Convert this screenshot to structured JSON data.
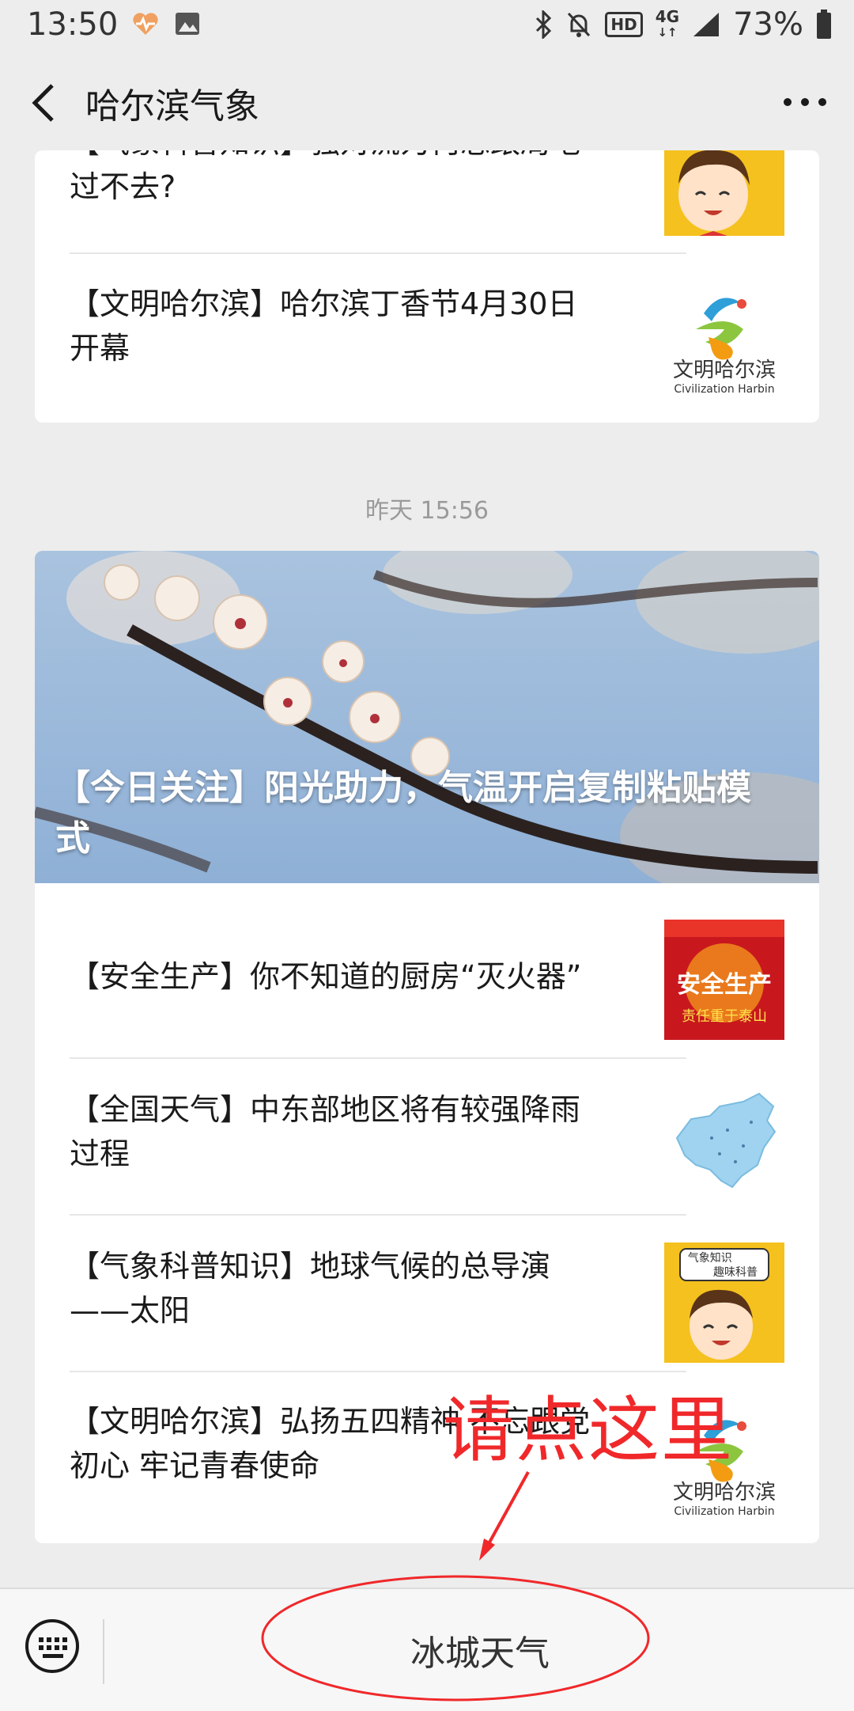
{
  "status_bar": {
    "time": "13:50",
    "battery": "73%",
    "hd_label": "HD",
    "network_label": "4G",
    "network_sub": "↓↑"
  },
  "nav": {
    "title": "哈尔滨气象"
  },
  "top_card": {
    "items": [
      {
        "title_partial": "【气象科普知识】强对流为何总跟局地",
        "title": "过不去?"
      },
      {
        "title": "【文明哈尔滨】哈尔滨丁香节4月30日\n开幕"
      }
    ]
  },
  "timestamp": "昨天 15:56",
  "main_card": {
    "cover_title": "【今日关注】阳光助力，气温开启复制粘贴模\n式",
    "items": [
      {
        "title": "【安全生产】你不知道的厨房“灭火器”",
        "thumb_caption": "安全生产",
        "thumb_sub": "责任重于泰山"
      },
      {
        "title": "【全国天气】中东部地区将有较强降雨\n过程"
      },
      {
        "title": "【气象科普知识】地球气候的总导演\n——太阳",
        "thumb_caption": "气象知识\n趣味科普"
      },
      {
        "title": "【文明哈尔滨】弘扬五四精神 不忘跟党\n初心 牢记青春使命"
      }
    ]
  },
  "logo": {
    "cn": "文明哈尔滨",
    "en": "Civilization Harbin"
  },
  "bottom_bar": {
    "menu_label": "冰城天气"
  },
  "annotation": {
    "text": "请点这里",
    "color": "#f0282a"
  },
  "colors": {
    "background": "#ededed",
    "card": "#ffffff",
    "annotation_red": "#f0282a"
  }
}
